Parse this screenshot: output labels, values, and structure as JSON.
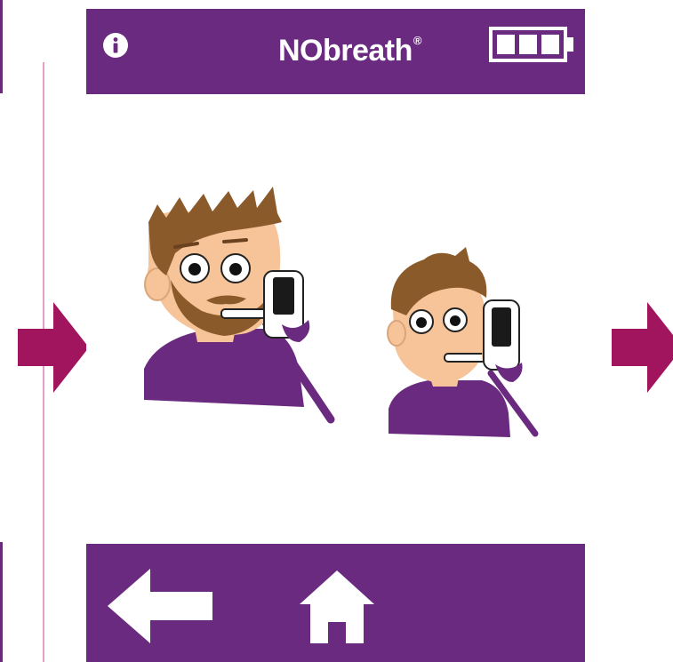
{
  "app": {
    "title": "NObreath",
    "trademark": "®"
  },
  "header": {
    "info_icon": "info-icon",
    "battery_icon": "battery-full-icon",
    "battery_level": 1.0
  },
  "footer": {
    "back_icon": "arrow-left-icon",
    "home_icon": "home-icon"
  },
  "nav": {
    "previous_icon": "arrow-right-icon",
    "next_icon": "arrow-right-icon"
  },
  "colors": {
    "brand_purple": "#6a2a7f",
    "accent_magenta": "#a0155e",
    "divider_pink": "#e5a0c8",
    "skin": "#f6c498",
    "hair": "#8b5a2b"
  }
}
